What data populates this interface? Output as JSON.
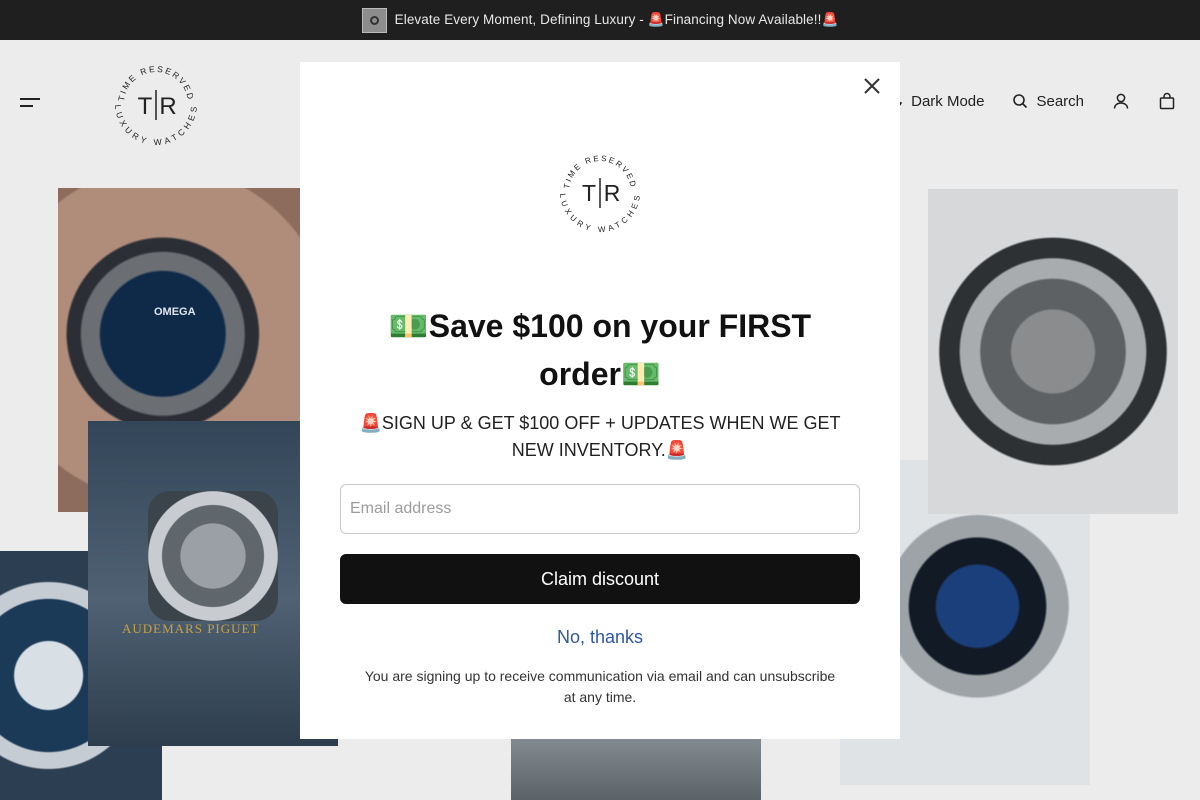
{
  "announcement": {
    "text": "Elevate Every Moment, Defining Luxury - 🚨Financing Now Available!!🚨"
  },
  "header": {
    "dark_mode_label": "Dark Mode",
    "search_label": "Search",
    "logo_text": {
      "monogram": "T|R",
      "ring_top": "TIME RESERVED",
      "ring_bottom": "LUXURY WATCHES"
    }
  },
  "background": {
    "omega_text": "OMEGA",
    "ap_text": "AUDEMARS PIGUET"
  },
  "modal": {
    "title": "💵Save $100 on your FIRST order💵",
    "subtitle": "🚨SIGN UP & GET $100 OFF + UPDATES WHEN WE GET NEW INVENTORY.🚨",
    "email_placeholder": "Email address",
    "claim_label": "Claim discount",
    "decline_label": "No, thanks",
    "disclaimer": "You are signing up to receive communication via email and can unsubscribe at any time."
  },
  "colors": {
    "announcement_bg": "#1f1f1f",
    "page_bg": "#ececec",
    "button_bg": "#111111",
    "link_color": "#2f56a8"
  },
  "icons": [
    "menu-icon",
    "moon-icon",
    "search-icon",
    "account-icon",
    "cart-icon",
    "close-icon"
  ]
}
